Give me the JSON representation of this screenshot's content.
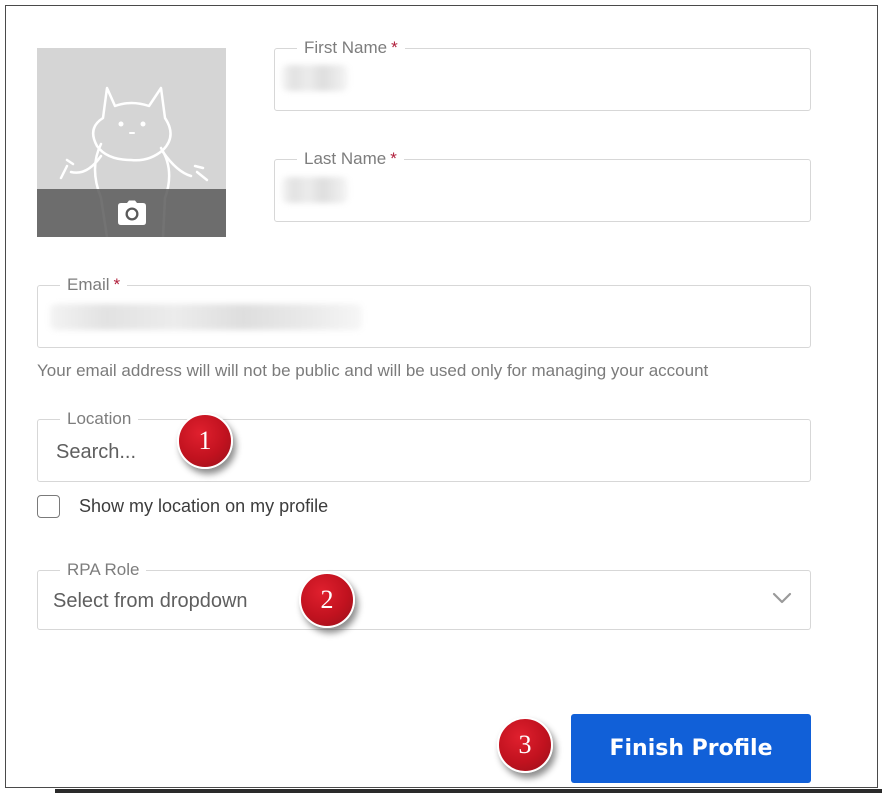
{
  "form": {
    "first_name": {
      "label": "First Name",
      "required_mark": "*"
    },
    "last_name": {
      "label": "Last Name",
      "required_mark": "*"
    },
    "email": {
      "label": "Email",
      "required_mark": "*",
      "helper": "Your email address will will not be public and will be used only for managing your account"
    },
    "location": {
      "label": "Location",
      "placeholder": "Search..."
    },
    "show_location": {
      "label": "Show my location on my profile",
      "checked": false
    },
    "rpa_role": {
      "label": "RPA Role",
      "placeholder": "Select from dropdown"
    },
    "submit_label": "Finish Profile"
  },
  "avatar": {
    "icon": "camera-icon"
  },
  "annotations": [
    "1",
    "2",
    "3"
  ],
  "colors": {
    "primary": "#1160d8",
    "required": "#b01e3a",
    "badge": "#c1121f"
  }
}
